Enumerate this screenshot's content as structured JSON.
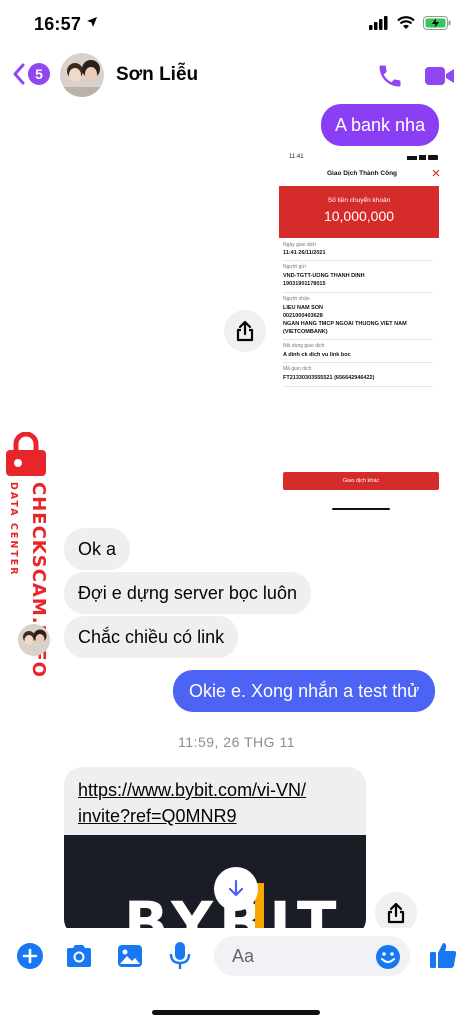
{
  "status_bar": {
    "time": "16:57"
  },
  "header": {
    "back_count": "5",
    "contact_name": "Sơn Liễu",
    "icons": [
      "back-chevron-icon",
      "phone-icon",
      "video-camera-icon"
    ]
  },
  "messages": {
    "out_1": "A bank nha",
    "in_1": "Ok a",
    "in_2": "Đợi e dựng server bọc luôn",
    "in_3": "Chắc chiều có link",
    "out_2": "Okie e. Xong nhắn a test thử",
    "timestamp": "11:59, 26 THG 11",
    "link_line1": "https://www.bybit.com/vi-VN/",
    "link_line2": "invite?ref=Q0MNR9"
  },
  "receipt": {
    "time": "11:41",
    "title": "Giao Dịch Thành Công",
    "amount_label": "Số tiền chuyển khoản",
    "amount": "10,000,000",
    "date_label": "Ngày giao dịch",
    "date": "11:41 26/11/2021",
    "sender_label": "Người gửi",
    "sender_name": "VND-TGTT-UONG THANH DINH",
    "sender_account": "19031901178015",
    "receiver_label": "Người nhận",
    "receiver_name": "LIEU NAM SON",
    "receiver_account": "0021000403628",
    "receiver_bank": "NGAN HANG TMCP NGOAI THUONG VIET NAM",
    "receiver_bank_short": "(VIETCOMBANK)",
    "content_label": "Nội dung giao dịch",
    "content": "A dinh ck dich vu link boc",
    "code_label": "Mã giao dịch",
    "code": "FT21330303555521 (656642946422)",
    "button": "Giao dịch khác"
  },
  "link_preview": {
    "brand": "BYBIT"
  },
  "watermark": {
    "main": "CHECKSCAM.INFO",
    "sub": "DATA CENTER"
  },
  "composer": {
    "placeholder": "Aa"
  },
  "colors": {
    "messenger_purple": "#8b3ff4",
    "messenger_blue": "#4c63f4",
    "icon_blue": "#1877f2",
    "receipt_red": "#d62b2b",
    "watermark_red": "#e8262a"
  }
}
